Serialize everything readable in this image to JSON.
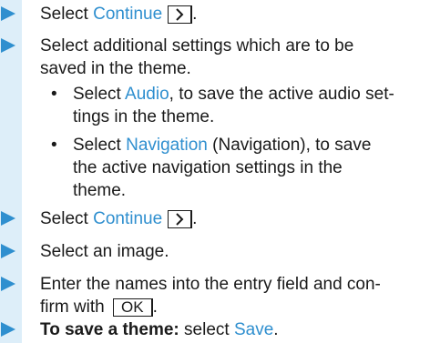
{
  "steps": {
    "s1": {
      "pre": "Select ",
      "link": "Continue"
    },
    "s2": {
      "line1": "Select additional settings which are to be",
      "line2": "saved in the theme."
    },
    "b1": {
      "dot": "•",
      "pre": "Select ",
      "link": "Audio",
      "post": ", to save the active audio set-",
      "line2": "tings in the theme."
    },
    "b2": {
      "dot": "•",
      "pre": "Select ",
      "link": "Navigation",
      "post": " (Navigation), to save",
      "line2": "the active navigation settings in the",
      "line3": "theme."
    },
    "s3": {
      "pre": "Select ",
      "link": "Continue"
    },
    "s4": {
      "text": "Select an image."
    },
    "s5": {
      "line1": "Enter the names into the entry field and con-",
      "line2_pre": "firm with ",
      "ok_key": "OK",
      "line2_post": "."
    },
    "s6": {
      "bold": "To save a theme:",
      "mid": " select ",
      "link": "Save",
      "post": "."
    }
  },
  "colors": {
    "accent": "#2f8fcf",
    "bar": "#ddeef9",
    "arrow": "#2f8fcf"
  },
  "icons": {
    "step_marker": "triangle-right-icon",
    "continue_key": "chevron-right-icon"
  }
}
